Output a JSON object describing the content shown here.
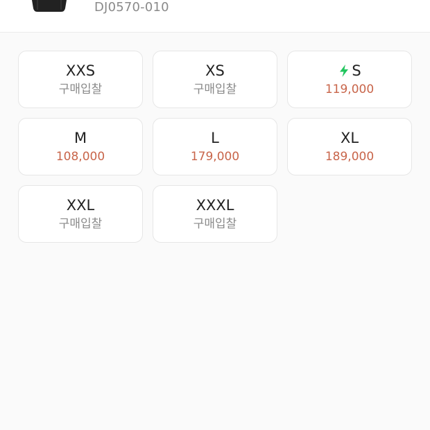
{
  "product": {
    "model_number": "DJ0570-010"
  },
  "colors": {
    "price": "#c8654a",
    "label_gray": "#8a8a8a",
    "fast_shipping": "#22c55e"
  },
  "sizes": [
    {
      "size": "XXS",
      "status": "구매입찰"
    },
    {
      "size": "XS",
      "status": "구매입찰"
    },
    {
      "size": "S",
      "price": "119,000",
      "icon": "lightning-bolt-icon"
    },
    {
      "size": "M",
      "price": "108,000"
    },
    {
      "size": "L",
      "price": "179,000"
    },
    {
      "size": "XL",
      "price": "189,000"
    },
    {
      "size": "XXL",
      "status": "구매입찰"
    },
    {
      "size": "XXXL",
      "status": "구매입찰"
    }
  ]
}
